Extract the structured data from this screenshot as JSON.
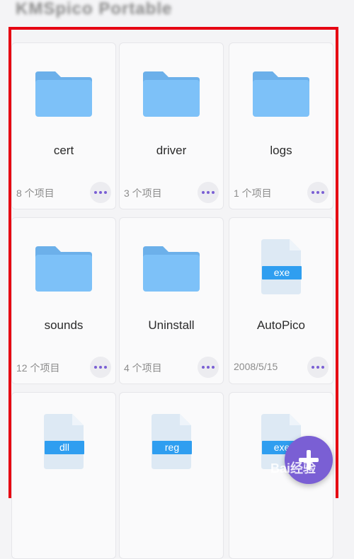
{
  "app": {
    "title": "KMSpico Portable",
    "accent_color": "#7a5fd4",
    "folder_color": "#7dc1f8",
    "highlight_color": "#e60012",
    "file_badge_color": "#2f9ef0"
  },
  "items": [
    {
      "name": "cert",
      "kind": "folder",
      "meta": "8 个项目"
    },
    {
      "name": "driver",
      "kind": "folder",
      "meta": "3 个项目"
    },
    {
      "name": "logs",
      "kind": "folder",
      "meta": "1 个项目"
    },
    {
      "name": "sounds",
      "kind": "folder",
      "meta": "12 个项目"
    },
    {
      "name": "Uninstall",
      "kind": "folder",
      "meta": "4 个项目"
    },
    {
      "name": "AutoPico",
      "kind": "file",
      "ext": "exe",
      "meta": "2008/5/15"
    },
    {
      "name": "",
      "kind": "file",
      "ext": "dll",
      "meta": ""
    },
    {
      "name": "",
      "kind": "file",
      "ext": "reg",
      "meta": ""
    },
    {
      "name": "",
      "kind": "file",
      "ext": "exe",
      "meta": ""
    }
  ],
  "fab": {
    "icon": "plus-icon"
  },
  "watermark": {
    "text": "Bai经验"
  }
}
